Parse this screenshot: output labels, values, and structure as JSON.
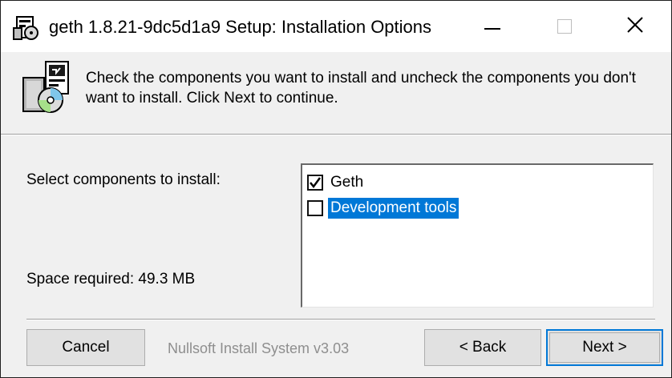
{
  "window": {
    "title": "geth 1.8.21-9dc5d1a9 Setup: Installation Options",
    "app_icon": "installer-icon",
    "controls": {
      "minimize": "minimize-icon",
      "maximize": "maximize-icon",
      "close": "close-icon"
    }
  },
  "header": {
    "icon": "installer-cd-icon",
    "description": "Check the components you want to install and uncheck the components you don't want to install. Click Next to continue."
  },
  "components": {
    "select_label": "Select components to install:",
    "items": [
      {
        "label": "Geth",
        "checked": true,
        "selected": false
      },
      {
        "label": "Development tools",
        "checked": false,
        "selected": true
      }
    ],
    "space_required": "Space required: 49.3 MB"
  },
  "footer": {
    "branding": "Nullsoft Install System v3.03",
    "cancel_label": "Cancel",
    "back_label": "< Back",
    "next_label": "Next >"
  },
  "colors": {
    "selection": "#0078d7",
    "dialog_bg": "#f0f0f0",
    "branding_text": "#8e8e8e"
  }
}
